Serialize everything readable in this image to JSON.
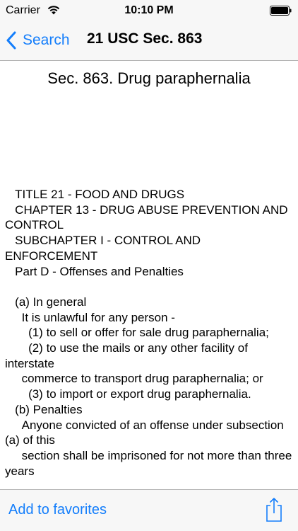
{
  "status_bar": {
    "carrier": "Carrier",
    "time": "10:10 PM"
  },
  "nav_bar": {
    "back_label": "Search",
    "title": "21 USC Sec. 863"
  },
  "document": {
    "heading": "Sec. 863. Drug paraphernalia",
    "body": "   TITLE 21 - FOOD AND DRUGS\n   CHAPTER 13 - DRUG ABUSE PREVENTION AND CONTROL\n   SUBCHAPTER I - CONTROL AND ENFORCEMENT\n   Part D - Offenses and Penalties\n\n   (a) In general\n     It is unlawful for any person -\n       (1) to sell or offer for sale drug paraphernalia;\n       (2) to use the mails or any other facility of interstate\n     commerce to transport drug paraphernalia; or\n       (3) to import or export drug paraphernalia.\n   (b) Penalties\n     Anyone convicted of an offense under subsection (a) of this\n     section shall be imprisoned for not more than three years"
  },
  "toolbar": {
    "favorites_label": "Add to favorites"
  },
  "colors": {
    "accent": "#147efb",
    "bar_background": "#f7f7f7"
  },
  "icons": {
    "wifi": "wifi-icon",
    "battery": "battery-icon",
    "back": "chevron-left-icon",
    "share": "share-icon"
  }
}
